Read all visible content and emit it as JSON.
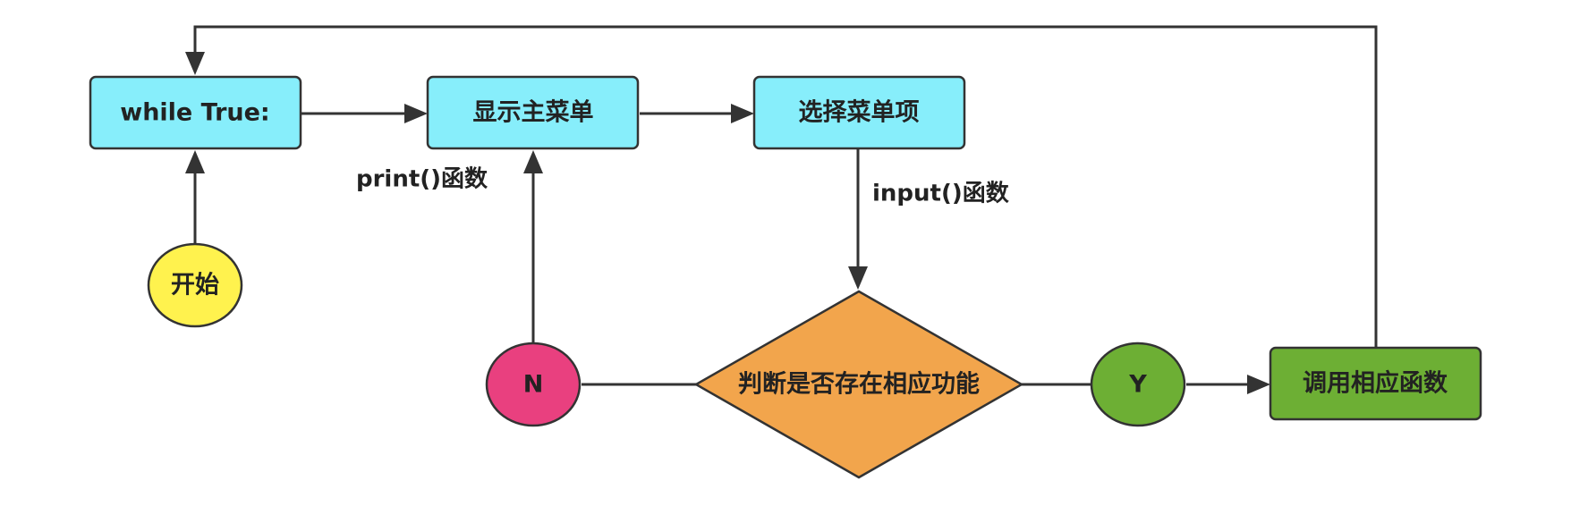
{
  "nodes": {
    "while_loop": {
      "label": "while True:",
      "color": "#87EEFB"
    },
    "show_menu": {
      "label": "显示主菜单",
      "color": "#87EEFB"
    },
    "select_item": {
      "label": "选择菜单项",
      "color": "#87EEFB"
    },
    "start": {
      "label": "开始",
      "color": "#FFF24E"
    },
    "decision": {
      "label": "判断是否存在相应功能",
      "color": "#F2A54C"
    },
    "no": {
      "label": "N",
      "color": "#E9407F"
    },
    "yes": {
      "label": "Y",
      "color": "#6DAF34"
    },
    "call_func": {
      "label": "调用相应函数",
      "color": "#6DAF34"
    }
  },
  "edge_labels": {
    "print": "print()函数",
    "input": "input()函数"
  },
  "colors": {
    "stroke": "#333333",
    "text": "#222222"
  }
}
